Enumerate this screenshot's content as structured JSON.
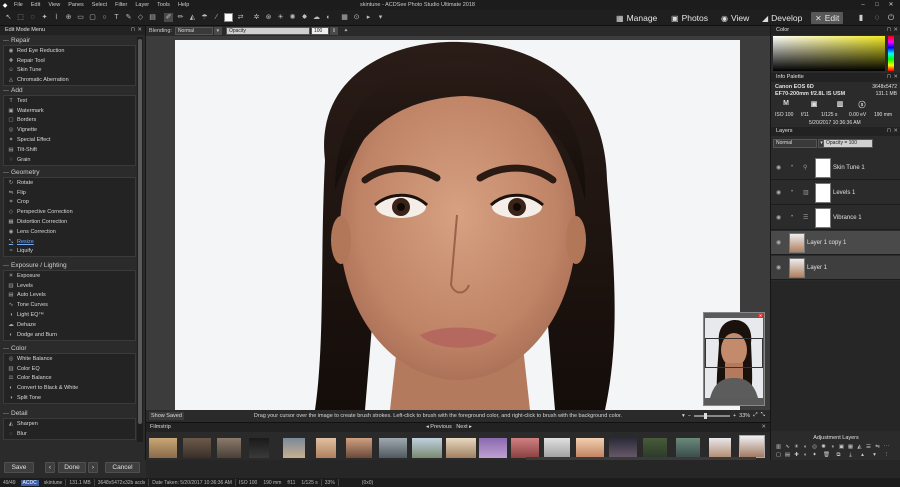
{
  "app": {
    "window_title": "skintune - ACDSee Photo Studio Ultimate 2018",
    "menus": [
      "File",
      "Edit",
      "View",
      "Panes",
      "Select",
      "Filter",
      "Layer",
      "Tools",
      "Help"
    ]
  },
  "modes": [
    {
      "label": "Manage",
      "icon": "manage-icon"
    },
    {
      "label": "Photos",
      "icon": "photos-icon"
    },
    {
      "label": "View",
      "icon": "view-icon"
    },
    {
      "label": "Develop",
      "icon": "develop-icon"
    },
    {
      "label": "Edit",
      "icon": "edit-icon",
      "active": true
    }
  ],
  "left_panel": {
    "title": "Edit Mode Menu",
    "sections": [
      {
        "title": "Repair",
        "items": [
          "Red Eye Reduction",
          "Repair Tool",
          "Skin Tune",
          "Chromatic Aberration"
        ]
      },
      {
        "title": "Add",
        "items": [
          "Text",
          "Watermark",
          "Borders",
          "Vignette",
          "Special Effect",
          "Tilt-Shift",
          "Grain"
        ]
      },
      {
        "title": "Geometry",
        "items": [
          "Rotate",
          "Flip",
          "Crop",
          "Perspective Correction",
          "Distortion Correction",
          "Lens Correction",
          "Resize",
          "Liquify"
        ]
      },
      {
        "title": "Exposure / Lighting",
        "items": [
          "Exposure",
          "Levels",
          "Auto Levels",
          "Tone Curves",
          "Light EQ™",
          "Dehaze",
          "Dodge and Burn"
        ]
      },
      {
        "title": "Color",
        "items": [
          "White Balance",
          "Color EQ",
          "Color Balance",
          "Convert to Black & White",
          "Split Tone"
        ]
      },
      {
        "title": "Detail",
        "items": [
          "Sharpen",
          "Blur"
        ]
      }
    ],
    "buttons": {
      "save": "Save",
      "done": "Done",
      "cancel": "Cancel"
    }
  },
  "options_bar": {
    "blending_label": "Blending:",
    "blending_value": "Normal",
    "opacity_label": "Opacity",
    "opacity_value": "100"
  },
  "canvas_status": {
    "show_saved": "Show Saved",
    "hint": "Drag your cursor over the image to create brush strokes. Left-click to brush with the foreground color, and right-click to brush with the background color.",
    "zoom": "33%"
  },
  "filmstrip": {
    "title": "Filmstrip",
    "prev": "Previous",
    "next": "Next"
  },
  "right_panel": {
    "color_title": "Color",
    "info_title": "Info Palette",
    "camera": "Canon EOS 6D",
    "dimensions": "3648x5472",
    "lens": "EF70-200mm f/2.8L IS USM",
    "filesize": "131.1 MB",
    "mode": "M",
    "iso": "ISO 100",
    "fstop": "f/11",
    "shutter": "1/125 s",
    "ev": "0.00 eV",
    "focal": "190 mm",
    "date": "5/20/2017 10:36:36 AM",
    "layers_title": "Layers",
    "blend_mode": "Normal",
    "opacity": "Opacity = 100",
    "layers": [
      {
        "name": "Skin Tune 1"
      },
      {
        "name": "Levels 1"
      },
      {
        "name": "Vibrance 1"
      },
      {
        "name": "Layer 1 copy 1"
      },
      {
        "name": "Layer 1"
      }
    ],
    "adjustment_title": "Adjustment Layers"
  },
  "statusbar": {
    "count": "49/49",
    "badge": "ACDC",
    "filename": "skintune",
    "size": "131.1 MB",
    "dims": "3648x5472x32b acds",
    "date_taken": "Date Taken: 5/20/2017 10:36:36 AM",
    "iso": "ISO 100",
    "focal": "190 mm",
    "fstop": "f/11",
    "shutter": "1/125 s",
    "zoom": "33%",
    "coords": "(0x0)"
  }
}
